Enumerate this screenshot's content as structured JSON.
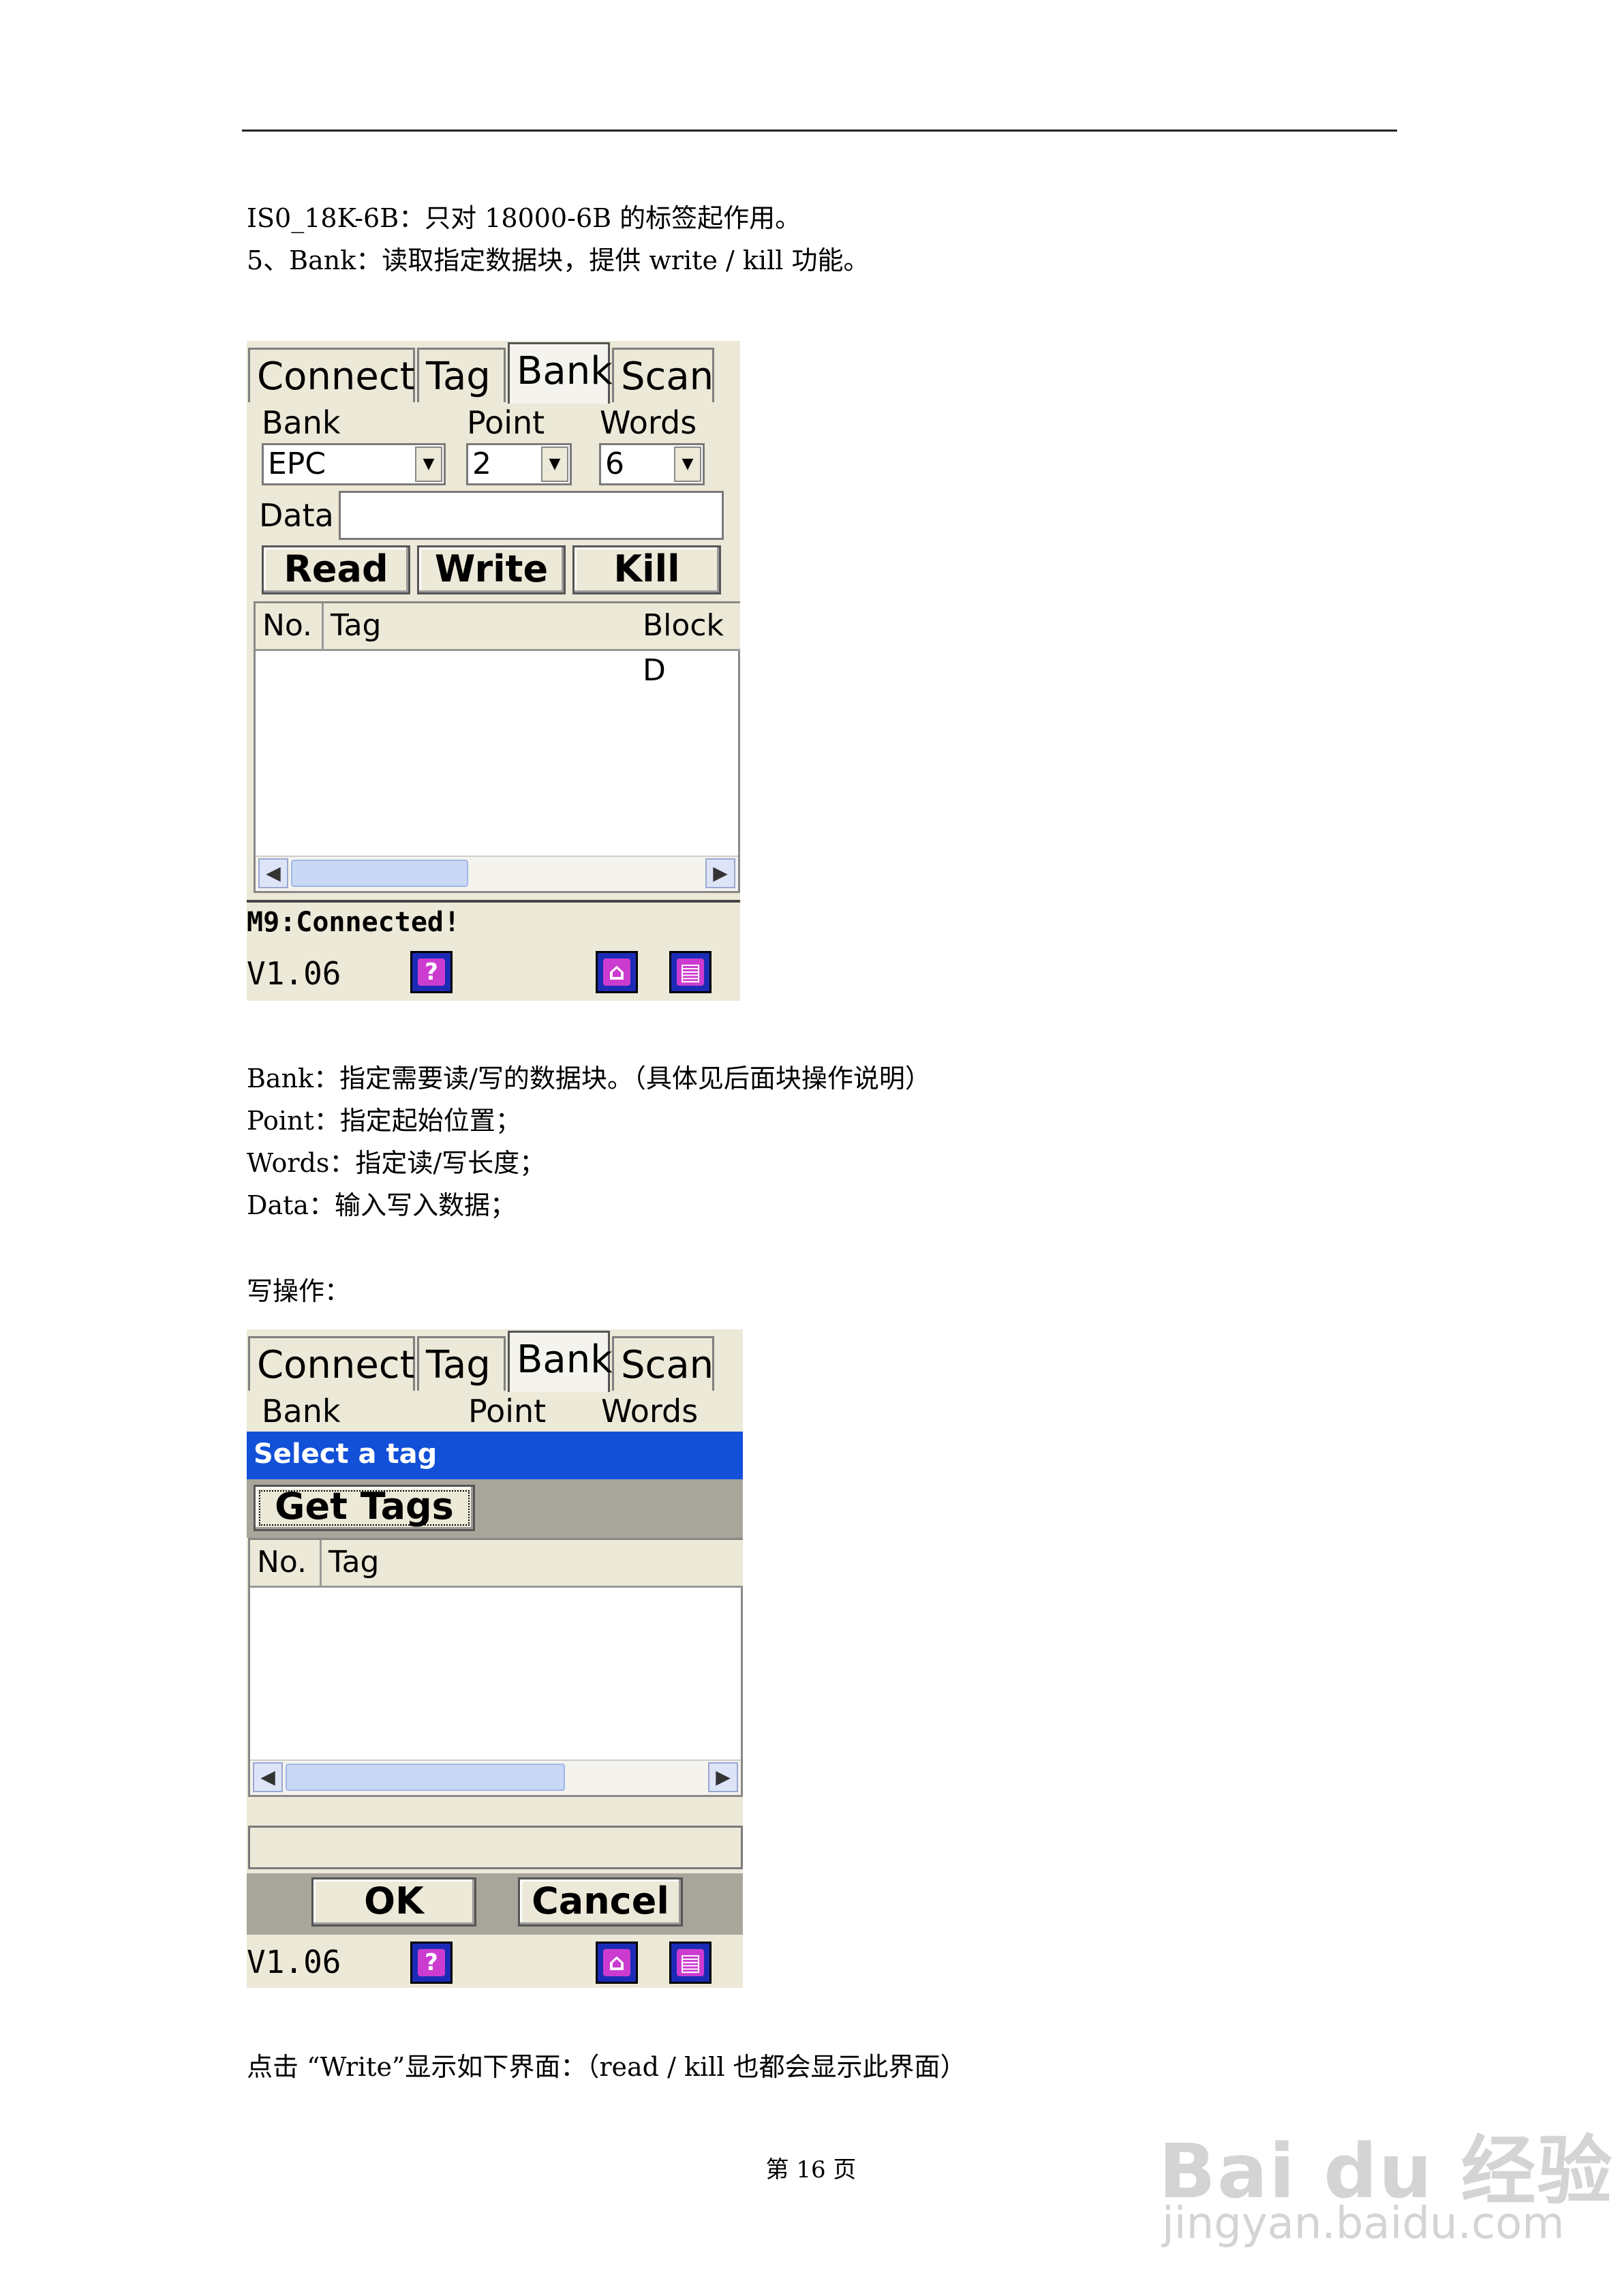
{
  "text": {
    "line1": "IS0_18K-6B：只对 18000-6B 的标签起作用。",
    "line2": "5、Bank：读取指定数据块，提供 write / kill 功能。",
    "desc_bank": "Bank：指定需要读/写的数据块。（具体见后面块操作说明）",
    "desc_point": "Point：指定起始位置；",
    "desc_words": "Words：指定读/写长度；",
    "desc_data": "Data：输入写入数据；",
    "write_op": "写操作：",
    "click_write": "点击 “Write”显示如下界面：（read / kill 也都会显示此界面）",
    "page_num": "第 16 页"
  },
  "shot1": {
    "tabs": [
      "Connect",
      "Tag",
      "Bank",
      "Scan"
    ],
    "bank_label": "Bank",
    "point_label": "Point",
    "words_label": "Words",
    "bank_value": "EPC",
    "point_value": "2",
    "words_value": "6",
    "data_label": "Data",
    "read_btn": "Read",
    "write_btn": "Write",
    "kill_btn": "Kill",
    "col_no": "No.",
    "col_tag": "Tag",
    "col_block": "Block D",
    "status": "M9:Connected!",
    "version": "V1.06"
  },
  "shot2": {
    "tabs": [
      "Connect",
      "Tag",
      "Bank",
      "Scan"
    ],
    "bank_label": "Bank",
    "point_label": "Point",
    "words_label": "Words",
    "select_title": "Select a tag",
    "get_tags_btn": "Get Tags",
    "col_no": "No.",
    "col_tag": "Tag",
    "ok_btn": "OK",
    "cancel_btn": "Cancel",
    "version": "V1.06"
  },
  "watermark": {
    "brand": "Bai du 经验",
    "url": "jingyan.baidu.com"
  }
}
